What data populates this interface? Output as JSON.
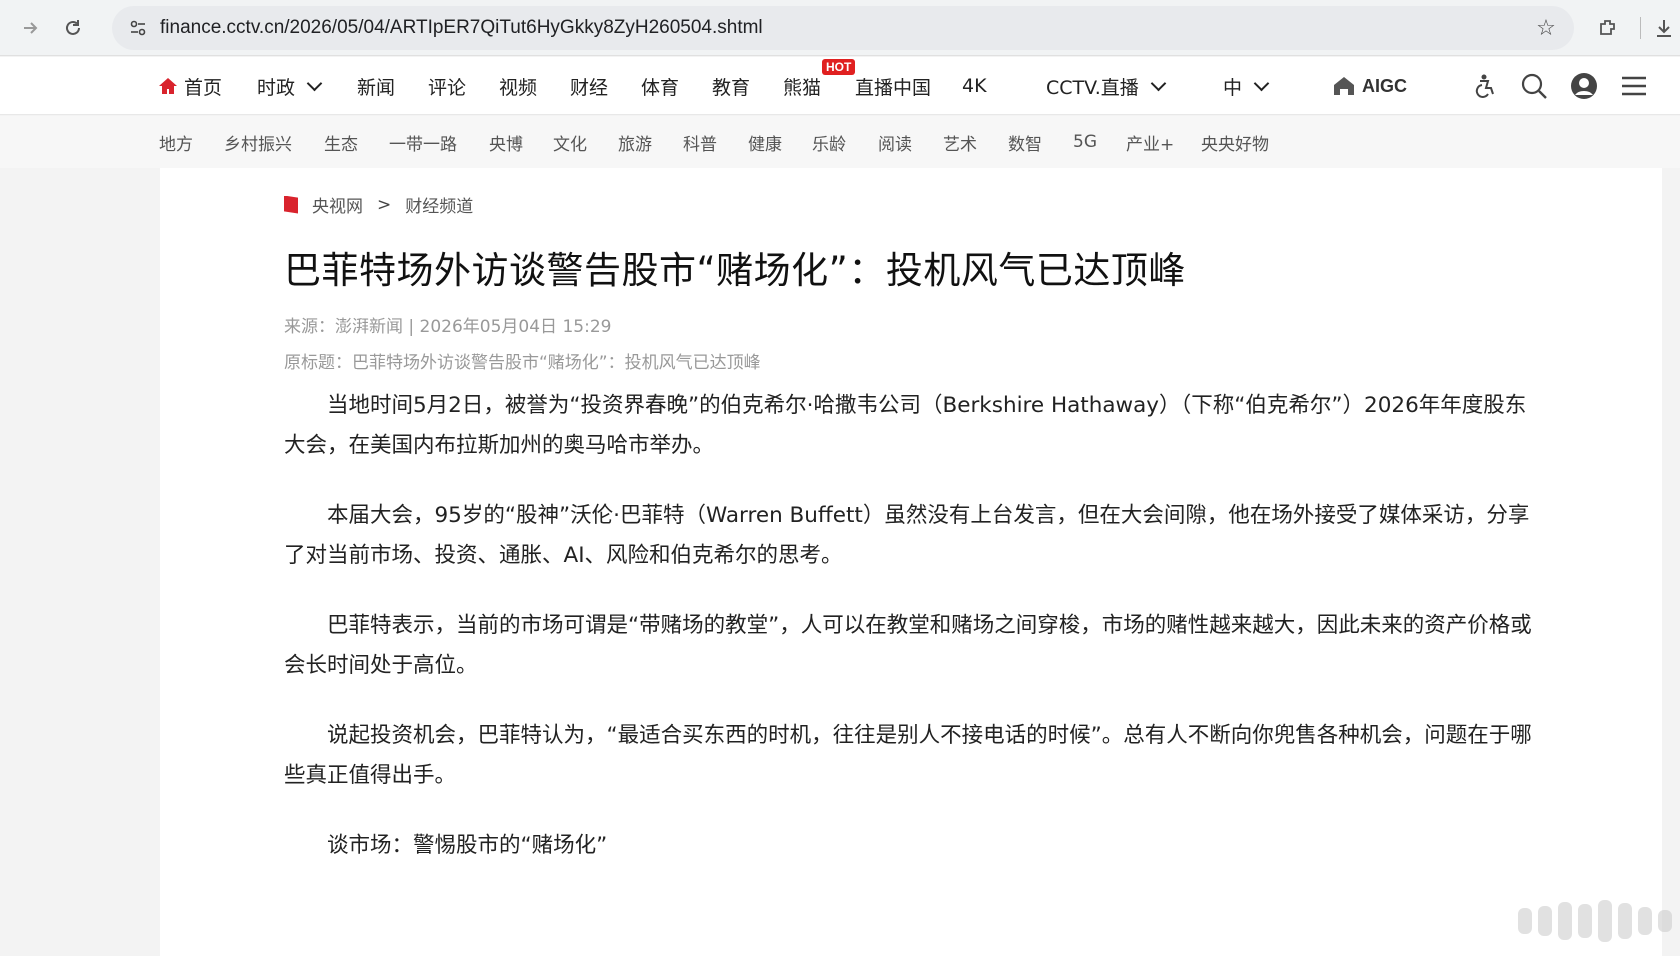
{
  "browser": {
    "url": "finance.cctv.cn/2026/05/04/ARTIpER7QiTut6HyGkky8ZyH260504.shtml"
  },
  "nav": {
    "home": "首页",
    "items": [
      "时政",
      "新闻",
      "评论",
      "视频",
      "财经",
      "体育",
      "教育",
      "熊猫",
      "直播中国",
      "4K"
    ],
    "hot_badge": "HOT",
    "cctv_live": "CCTV.直播",
    "lang": "中",
    "aigc": "AIGC"
  },
  "subnav": {
    "items": [
      "地方",
      "乡村振兴",
      "生态",
      "一带一路",
      "央博",
      "文化",
      "旅游",
      "科普",
      "健康",
      "乐龄",
      "阅读",
      "艺术",
      "数智",
      "5G",
      "产业+",
      "央央好物"
    ]
  },
  "article": {
    "breadcrumb": {
      "site": "央视网",
      "sep": ">",
      "channel": "财经频道"
    },
    "title": "巴菲特场外访谈警告股市“赌场化”：投机风气已达顶峰",
    "meta": "来源：澎湃新闻 | 2026年05月04日 15:29",
    "original_title": "原标题：巴菲特场外访谈警告股市“赌场化”：投机风气已达顶峰",
    "paragraphs": [
      "当地时间5月2日，被誉为“投资界春晚”的伯克希尔·哈撒韦公司（Berkshire Hathaway）（下称“伯克希尔”）2026年年度股东大会，在美国内布拉斯加州的奥马哈市举办。",
      "本届大会，95岁的“股神”沃伦·巴菲特（Warren Buffett）虽然没有上台发言，但在大会间隙，他在场外接受了媒体采访，分享了对当前市场、投资、通胀、AI、风险和伯克希尔的思考。",
      "巴菲特表示，当前的市场可谓是“带赌场的教堂”，人可以在教堂和赌场之间穿梭，市场的赌性越来越大，因此未来的资产价格或会长时间处于高位。",
      "说起投资机会，巴菲特认为，“最适合买东西的时机，往往是别人不接电话的时候”。总有人不断向你兜售各种机会，问题在于哪些真正值得出手。"
    ],
    "subheading": "谈市场：警惕股市的“赌场化”"
  },
  "colors": {
    "brand_red": "#d9232d",
    "hot_red": "#e02020"
  }
}
